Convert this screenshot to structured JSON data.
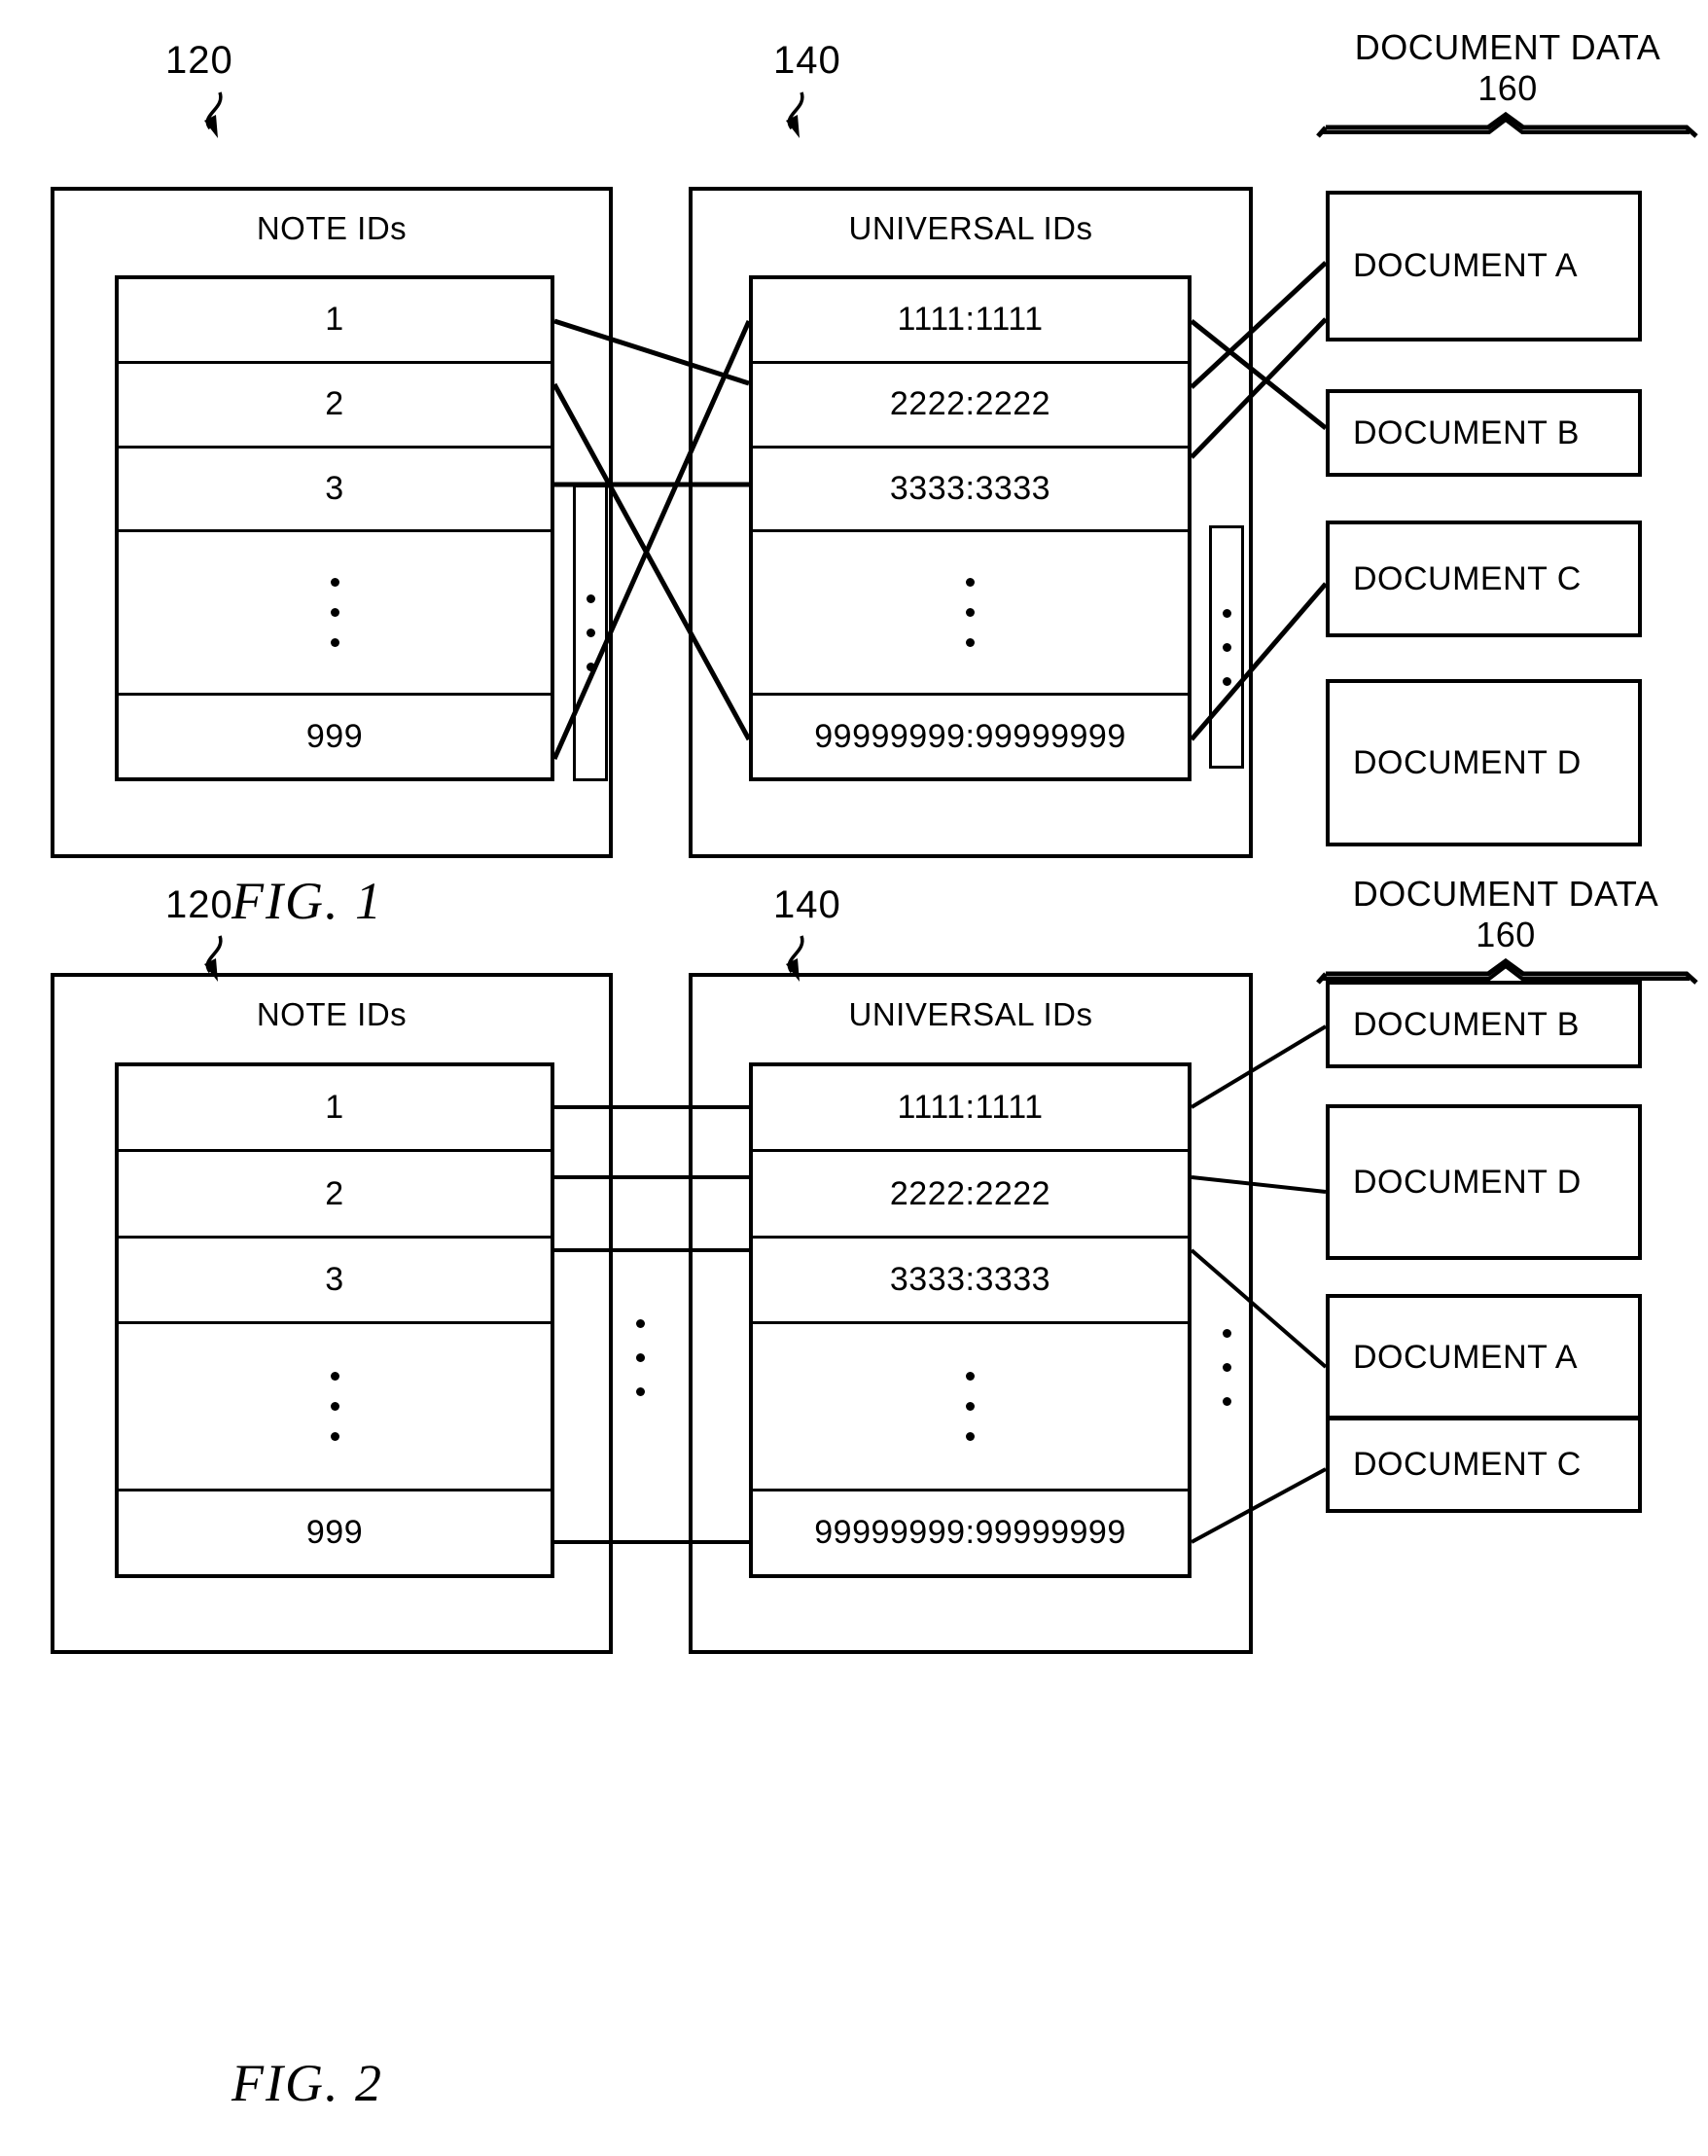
{
  "figures": [
    {
      "caption": "FIG. 1",
      "note_ids": {
        "ref": "120",
        "title": "NOTE IDs",
        "rows": [
          "1",
          "2",
          "3",
          "•",
          "999"
        ]
      },
      "universal_ids": {
        "ref": "140",
        "title": "UNIVERSAL IDs",
        "rows": [
          "1111:1111",
          "2222:2222",
          "3333:3333",
          "•",
          "99999999:99999999"
        ]
      },
      "document_data": {
        "ref": "160",
        "label_line1": "DOCUMENT DATA",
        "label_line2": "160",
        "documents": [
          "DOCUMENT A",
          "DOCUMENT B",
          "DOCUMENT C",
          "DOCUMENT D"
        ]
      },
      "mapping_note_to_universal": [
        {
          "note": "1",
          "universal": "2222:2222"
        },
        {
          "note": "2",
          "universal": "99999999:99999999"
        },
        {
          "note": "3",
          "universal": "3333:3333"
        },
        {
          "note": "999",
          "universal": "1111:1111"
        }
      ],
      "mapping_universal_to_document": [
        {
          "universal": "1111:1111",
          "document": "DOCUMENT B"
        },
        {
          "universal": "2222:2222",
          "document": "DOCUMENT A"
        },
        {
          "universal": "3333:3333",
          "document": "DOCUMENT A"
        },
        {
          "universal": "99999999:99999999",
          "document": "DOCUMENT C"
        }
      ]
    },
    {
      "caption": "FIG. 2",
      "note_ids": {
        "ref": "120",
        "title": "NOTE IDs",
        "rows": [
          "1",
          "2",
          "3",
          "•",
          "999"
        ]
      },
      "universal_ids": {
        "ref": "140",
        "title": "UNIVERSAL IDs",
        "rows": [
          "1111:1111",
          "2222:2222",
          "3333:3333",
          "•",
          "99999999:99999999"
        ]
      },
      "document_data": {
        "ref": "160",
        "label_line1": "DOCUMENT DATA",
        "label_line2": "160",
        "documents": [
          "DOCUMENT B",
          "DOCUMENT D",
          "DOCUMENT A",
          "DOCUMENT C"
        ]
      },
      "mapping_note_to_universal": [
        {
          "note": "1",
          "universal": "1111:1111"
        },
        {
          "note": "2",
          "universal": "2222:2222"
        },
        {
          "note": "3",
          "universal": "3333:3333"
        },
        {
          "note": "999",
          "universal": "99999999:99999999"
        }
      ],
      "mapping_universal_to_document": [
        {
          "universal": "1111:1111",
          "document": "DOCUMENT B"
        },
        {
          "universal": "2222:2222",
          "document": "DOCUMENT D"
        },
        {
          "universal": "3333:3333",
          "document": "DOCUMENT A"
        },
        {
          "universal": "99999999:99999999",
          "document": "DOCUMENT C"
        }
      ]
    }
  ],
  "colors": {
    "ink": "#000000",
    "paper": "#ffffff"
  }
}
